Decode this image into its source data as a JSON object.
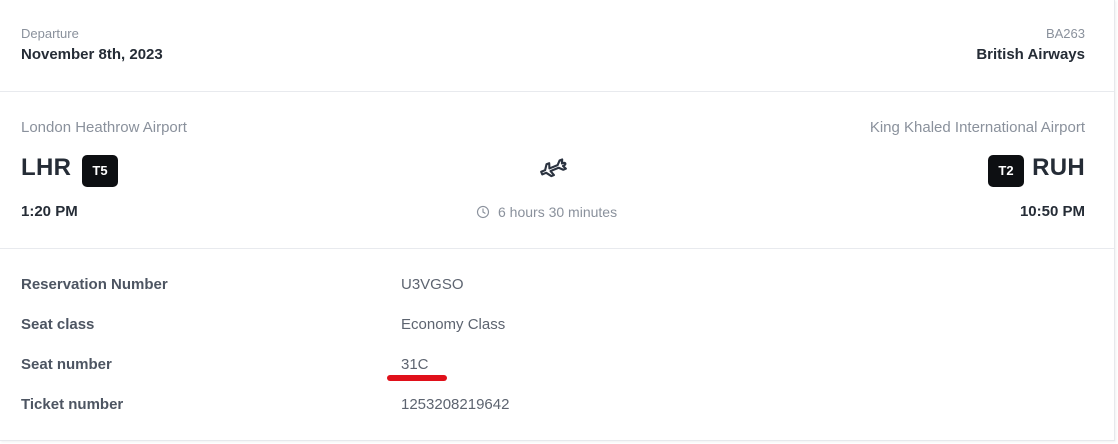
{
  "header": {
    "departure_label": "Departure",
    "departure_date": "November 8th, 2023",
    "flight_number": "BA263",
    "airline": "British Airways"
  },
  "route": {
    "origin": {
      "airport_name": "London Heathrow Airport",
      "code": "LHR",
      "terminal": "T5",
      "time": "1:20 PM"
    },
    "destination": {
      "airport_name": "King Khaled International Airport",
      "code": "RUH",
      "terminal": "T2",
      "time": "10:50 PM"
    },
    "plane_icon": "airplane-icon",
    "duration_icon": "clock-icon",
    "duration": "6 hours 30 minutes"
  },
  "details": {
    "rows": [
      {
        "label": "Reservation Number",
        "value": "U3VGSO"
      },
      {
        "label": "Seat class",
        "value": "Economy Class"
      },
      {
        "label": "Seat number",
        "value": "31C"
      },
      {
        "label": "Ticket number",
        "value": "1253208219642"
      }
    ],
    "highlight_color": "#e0101a"
  },
  "colors": {
    "terminal_badge_bg": "#0d0f12",
    "muted_text": "#8a919c",
    "strong_text": "#252c36"
  }
}
